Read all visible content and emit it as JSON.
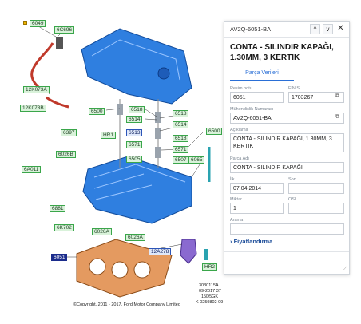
{
  "diagram": {
    "callouts": [
      {
        "label": "6049"
      },
      {
        "label": "6C696"
      },
      {
        "label": "12K073A"
      },
      {
        "label": "12K073B"
      },
      {
        "label": "6397"
      },
      {
        "label": "6026B"
      },
      {
        "label": "6A011"
      },
      {
        "label": "6881"
      },
      {
        "label": "6K702"
      },
      {
        "label": "6026A"
      },
      {
        "label": "6026A"
      },
      {
        "label": "6051"
      },
      {
        "label": "6500"
      },
      {
        "label": "6518"
      },
      {
        "label": "6514"
      },
      {
        "label": "6518"
      },
      {
        "label": "6514"
      },
      {
        "label": "6513"
      },
      {
        "label": "6571"
      },
      {
        "label": "6505"
      },
      {
        "label": "6518"
      },
      {
        "label": "6513"
      },
      {
        "label": "6571"
      },
      {
        "label": "6507"
      },
      {
        "label": "6500"
      },
      {
        "label": "6065"
      },
      {
        "label": "HR1"
      },
      {
        "label": "HR2"
      },
      {
        "label": "12A278"
      }
    ],
    "copyright": "©Copyright, 2011 - 2017, Ford Motor Company Limited",
    "ref_code_1": "3030115A",
    "ref_code_2": "09-2017 37",
    "ref_code_3": "15D5GK",
    "ref_code_4": "K 0259802 09"
  },
  "panel": {
    "header_code": "AV2Q-6051-BA",
    "prev_icon": "chevron-up-icon",
    "next_icon": "chevron-down-icon",
    "close_icon": "close-icon",
    "up_glyph": "^",
    "down_glyph": "v",
    "close_glyph": "✕",
    "title": "CONTA - SILINDIR KAPAĞI, 1.30MM, 3 KERTIK",
    "tab_label": "Parça Verileri",
    "fields": {
      "resim_notu_label": "Resim notu",
      "resim_notu_value": "6051",
      "finis_label": "FINIS",
      "finis_value": "1703267",
      "muhendislik_label": "Mühendislik Numarası",
      "muhendislik_value": "AV2Q-6051-BA",
      "aciklama_label": "Açıklama",
      "aciklama_value": "CONTA - SILINDIR KAPAĞI, 1.30MM, 3 KERTIK",
      "parca_adi_label": "Parça Adı",
      "parca_adi_value": "CONTA - SILINDIR KAPAĞI",
      "ilk_label": "İlk",
      "ilk_value": "07.04.2014",
      "son_label": "Son",
      "son_value": "",
      "miktar_label": "Miktar",
      "miktar_value": "1",
      "osi_label": "OSI",
      "osi_value": "",
      "arama_label": "Arama",
      "arama_value": ""
    },
    "price_label": "Fiyatlandırma",
    "colors": {
      "accent": "#2a6fd6",
      "engine_blue": "#2f7fe0",
      "callout_green": "#3aa64a",
      "gasket_orange": "#c8682a"
    }
  }
}
